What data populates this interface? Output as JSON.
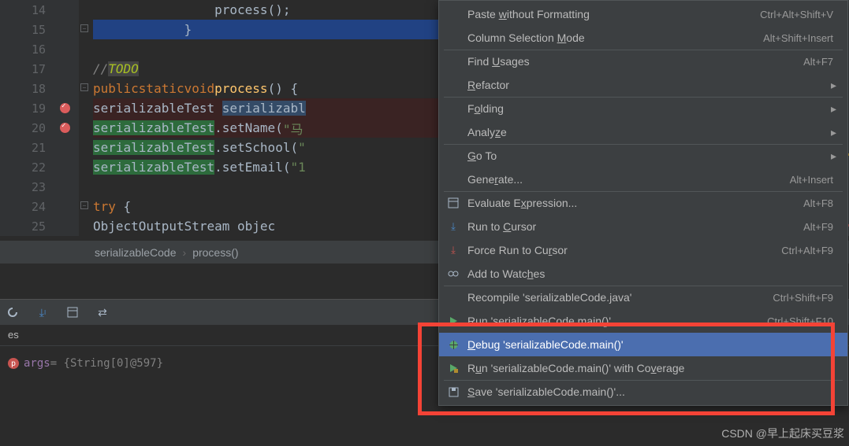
{
  "gutter": [
    "14",
    "15",
    "16",
    "17",
    "18",
    "19",
    "20",
    "21",
    "22",
    "23",
    "24",
    "25"
  ],
  "breakpoints": [
    "19",
    "20"
  ],
  "code": {
    "l14": "                process();",
    "l15_brace": "            }",
    "l17_comment": "//",
    "l17_todo": "TODO",
    "l18_kw1": "public",
    "l18_kw2": "static",
    "l18_kw3": "void",
    "l18_mtd": "process",
    "l18_tail": "() {",
    "l19_a": "serializableTest ",
    "l19_b": "serializabl",
    "l20_a": "serializableTest",
    "l20_b": ".setName(",
    "l20_c": "\"马",
    "l21_a": "serializableTest",
    "l21_b": ".setSchool(",
    "l21_c": "\"",
    "l22_a": "serializableTest",
    "l22_b": ".setEmail(",
    "l22_c": "\"1",
    "l24_kw": "try",
    "l24_brace": " {",
    "l25": "ObjectOutputStream objec"
  },
  "crumbs": {
    "a": "serializableCode",
    "b": "process()"
  },
  "panel": {
    "tab": "es",
    "var_name": "args",
    "var_val": " = {String[0]@597}"
  },
  "menu": [
    {
      "label": "Paste <u>w</u>ithout Formatting",
      "sc": "Ctrl+Alt+Shift+V"
    },
    {
      "label": "Column Selection <u>M</u>ode",
      "sc": "Alt+Shift+Insert",
      "sep": true
    },
    {
      "label": "Find <u>U</u>sages",
      "sc": "Alt+F7"
    },
    {
      "label": "<u>R</u>efactor",
      "sub": true,
      "sep": true
    },
    {
      "label": "F<u>o</u>lding",
      "sub": true
    },
    {
      "label": "Analy<u>z</u>e",
      "sub": true,
      "sep": true
    },
    {
      "label": "<u>G</u>o To",
      "sub": true
    },
    {
      "label": "Gene<u>r</u>ate...",
      "sc": "Alt+Insert",
      "sep": true
    },
    {
      "label": "Evaluate E<u>x</u>pression...",
      "sc": "Alt+F8",
      "icon": "calc"
    },
    {
      "label": "Run to <u>C</u>ursor",
      "sc": "Alt+F9",
      "icon": "runto"
    },
    {
      "label": "Force Run to Cu<u>r</u>sor",
      "sc": "Ctrl+Alt+F9",
      "icon": "forcerun"
    },
    {
      "label": "Add to Watc<u>h</u>es",
      "icon": "watch",
      "sep": true
    },
    {
      "label": "Recompile 'serializableCode.java'",
      "sc": "Ctrl+Shift+F9"
    },
    {
      "label": "Ru<u>n</u> 'serializableCode.main()'",
      "sc": "Ctrl+Shift+F10",
      "icon": "run"
    },
    {
      "label": "<u>D</u>ebug 'serializableCode.main()'",
      "icon": "debug",
      "sel": true
    },
    {
      "label": "R<u>u</u>n 'serializableCode.main()' with Co<u>v</u>erage",
      "icon": "cover",
      "sep": true
    },
    {
      "label": "<u>S</u>ave 'serializableCode.main()'...",
      "icon": "save"
    }
  ],
  "watermark": "CSDN @早上起床买豆浆"
}
